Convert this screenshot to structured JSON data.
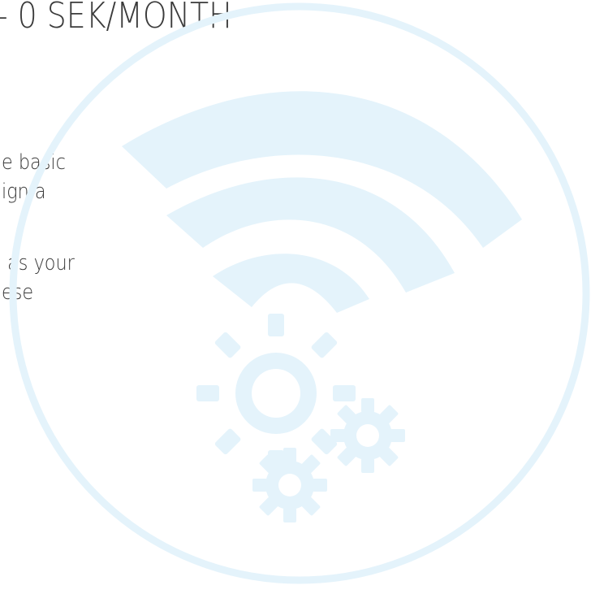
{
  "heading": "- 0 SEK/MONTH",
  "paragraphs": [
    {
      "lines": [
        "e basic",
        "ign a"
      ]
    },
    {
      "lines": [
        " as your",
        "ese"
      ]
    }
  ],
  "illustration": {
    "icon": "wifi-gears-icon",
    "color": "#e4f3fb"
  }
}
